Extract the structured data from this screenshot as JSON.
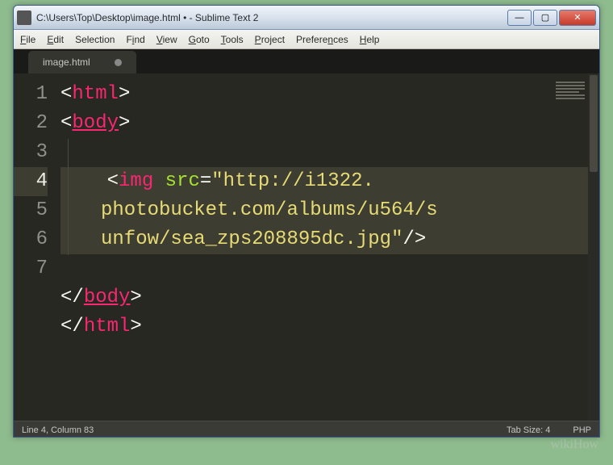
{
  "window": {
    "title": "C:\\Users\\Top\\Desktop\\image.html • - Sublime Text 2"
  },
  "menu": {
    "file": "File",
    "edit": "Edit",
    "selection": "Selection",
    "find": "Find",
    "view": "View",
    "goto": "Goto",
    "tools": "Tools",
    "project": "Project",
    "preferences": "Preferences",
    "help": "Help"
  },
  "tab": {
    "name": "image.html"
  },
  "gutter": {
    "l1": "1",
    "l2": "2",
    "l3": "3",
    "l4": "4",
    "lw1": " ",
    "lw2": " ",
    "l5": "5",
    "l6": "6",
    "l7": "7"
  },
  "code": {
    "lt": "<",
    "gt": ">",
    "slash": "/",
    "sp4": "    ",
    "html": "html",
    "body": "body",
    "img": "img",
    "src": "src",
    "eq": "=",
    "q": "\"",
    "url1": "http://i1322.",
    "url2": "photobucket.com/albums/u564/s",
    "url3": "unfow/sea_zps208895dc.jpg",
    "closer": "/>"
  },
  "status": {
    "left": "Line 4, Column 83",
    "tabsize": "Tab Size: 4",
    "lang": "PHP"
  },
  "watermark": "wikiHow",
  "win_buttons": {
    "min": "—",
    "max": "▢",
    "close": "✕"
  }
}
